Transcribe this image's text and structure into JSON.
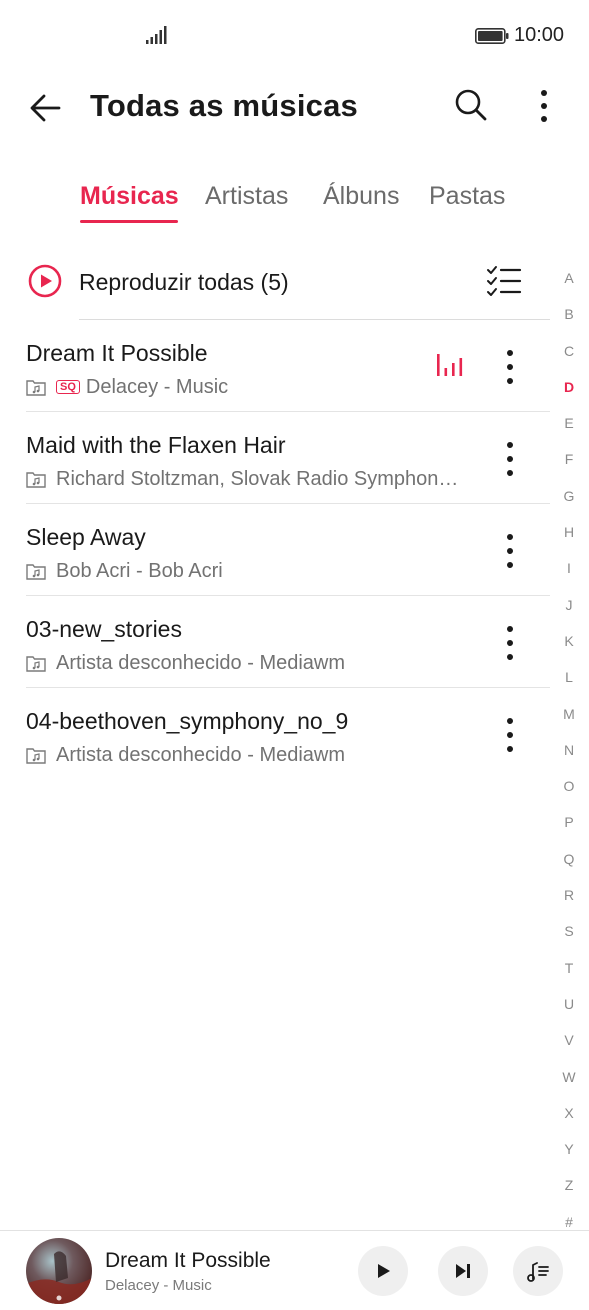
{
  "status_bar": {
    "time": "10:00"
  },
  "header": {
    "title": "Todas as músicas"
  },
  "tabs": [
    {
      "label": "Músicas",
      "active": true
    },
    {
      "label": "Artistas",
      "active": false
    },
    {
      "label": "Álbuns",
      "active": false
    },
    {
      "label": "Pastas",
      "active": false
    }
  ],
  "play_all": {
    "label": "Reproduzir todas (5)"
  },
  "songs": [
    {
      "title": "Dream It Possible",
      "subtitle": "Delacey - Music",
      "badge": "SQ",
      "playing": true
    },
    {
      "title": "Maid with the Flaxen Hair",
      "subtitle": "Richard Stoltzman, Slovak Radio Symphon…",
      "badge": "",
      "playing": false
    },
    {
      "title": "Sleep Away",
      "subtitle": "Bob Acri - Bob Acri",
      "badge": "",
      "playing": false
    },
    {
      "title": "03-new_stories",
      "subtitle": "Artista desconhecido - Mediawm",
      "badge": "",
      "playing": false
    },
    {
      "title": "04-beethoven_symphony_no_9",
      "subtitle": "Artista desconhecido - Mediawm",
      "badge": "",
      "playing": false
    }
  ],
  "alphabet": [
    "A",
    "B",
    "C",
    "D",
    "E",
    "F",
    "G",
    "H",
    "I",
    "J",
    "K",
    "L",
    "M",
    "N",
    "O",
    "P",
    "Q",
    "R",
    "S",
    "T",
    "U",
    "V",
    "W",
    "X",
    "Y",
    "Z",
    "#"
  ],
  "alphabet_active": "D",
  "mini_player": {
    "title": "Dream It Possible",
    "artist": "Delacey - Music"
  },
  "colors": {
    "accent": "#e8264f",
    "text": "#1a1a1a",
    "secondary": "#727272",
    "divider": "#e4e4e4"
  },
  "icons": {
    "status": [
      "signal-icon",
      "battery-icon"
    ],
    "header": [
      "back-arrow-icon",
      "search-icon",
      "more-vertical-icon"
    ],
    "play_all": [
      "play-circle-icon",
      "multi-select-list-icon"
    ],
    "song": [
      "local-music-folder-icon",
      "equalizer-icon",
      "more-vertical-icon"
    ],
    "mini_player": [
      "album-art",
      "play-icon",
      "next-icon",
      "playlist-icon"
    ]
  }
}
